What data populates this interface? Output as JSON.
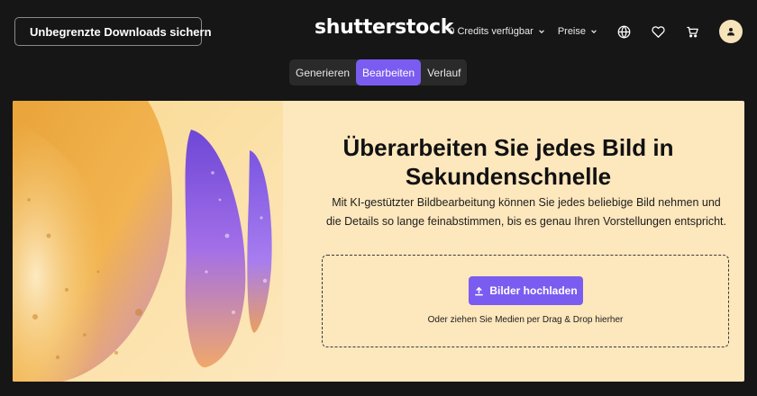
{
  "header": {
    "promo_label": "Unbegrenzte Downloads sichern",
    "logo_text": "shutterstock",
    "credits_label": "0 Credits verfügbar",
    "prices_label": "Preise"
  },
  "tabs": [
    {
      "label": "Generieren",
      "active": false
    },
    {
      "label": "Bearbeiten",
      "active": true
    },
    {
      "label": "Verlauf",
      "active": false
    }
  ],
  "hero": {
    "title": "Überarbeiten Sie jedes Bild in Sekundenschnelle",
    "description": "Mit KI-gestützter Bildbearbeitung können Sie jedes beliebige Bild nehmen und die Details so lange feinabstimmen, bis es genau Ihren Vorstellungen entspricht.",
    "upload_label": "Bilder hochladen",
    "drop_hint": "Oder ziehen Sie Medien per Drag & Drop hierher"
  },
  "colors": {
    "accent": "#7b5cf0",
    "background": "#161616",
    "hero_background": "#fde7bd",
    "avatar": "#f6e3ba"
  },
  "icons": {
    "promo": "rocket-icon",
    "credits": "chevron-down-icon",
    "prices": "chevron-down-icon",
    "language": "globe-icon",
    "favorites": "heart-icon",
    "cart": "cart-icon",
    "account": "user-icon",
    "upload": "upload-icon"
  }
}
